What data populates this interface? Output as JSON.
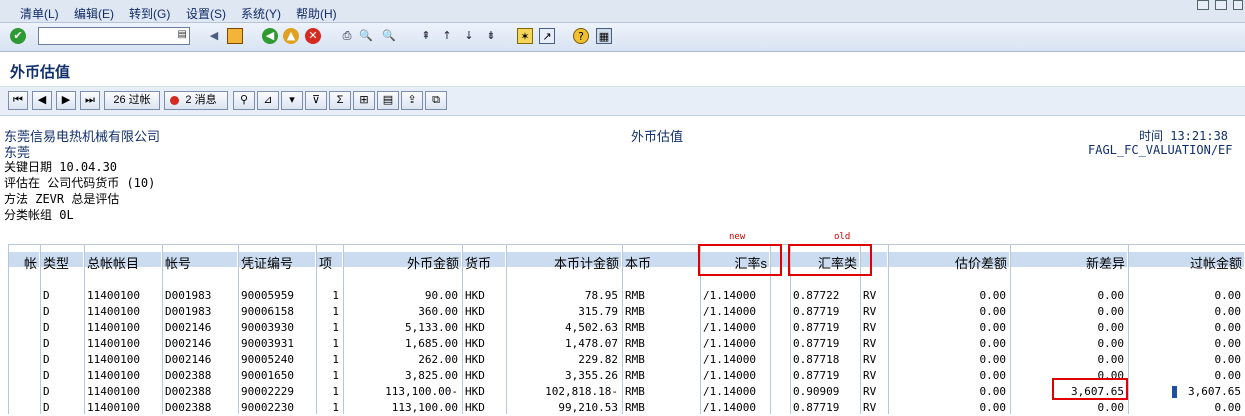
{
  "menu": {
    "items": [
      "清单(L)",
      "编辑(E)",
      "转到(G)",
      "设置(S)",
      "系统(Y)",
      "帮助(H)"
    ]
  },
  "toolbar": {
    "command_field_value": ""
  },
  "page": {
    "title": "外币估值"
  },
  "app_toolbar": {
    "posting_button": "26 过帐",
    "messages_button": "2 消息"
  },
  "report_header": {
    "company": "东莞信易电热机械有限公司",
    "city": "东莞",
    "key_date": "关键日期 10.04.30",
    "valuation_in": "评估在 公司代码货币 (10)",
    "method": "方法 ZEVR 总是评估",
    "ledger_group": "分类帐组 0L",
    "center_title": "外币估值",
    "time": "时间 13:21:38",
    "program": "FAGL_FC_VALUATION/EF"
  },
  "annotations": {
    "new_label": "new",
    "old_label": "old"
  },
  "table": {
    "columns": [
      "帐",
      "类型",
      "总帐帐目",
      "帐号",
      "凭证编号",
      "项",
      "外币金额",
      "货币",
      "本币计金额",
      "本币",
      "汇率s",
      "",
      "汇率类",
      "",
      "估价差额",
      "新差异",
      "过帐金额"
    ],
    "rows": [
      [
        "",
        "D",
        "11400100",
        "D001983",
        "90005959",
        "1",
        "90.00",
        "HKD",
        "78.95",
        "RMB",
        "/1.14000",
        "",
        "0.87722",
        "RV",
        "0.00",
        "0.00",
        "0.00"
      ],
      [
        "",
        "D",
        "11400100",
        "D001983",
        "90006158",
        "1",
        "360.00",
        "HKD",
        "315.79",
        "RMB",
        "/1.14000",
        "",
        "0.87719",
        "RV",
        "0.00",
        "0.00",
        "0.00"
      ],
      [
        "",
        "D",
        "11400100",
        "D002146",
        "90003930",
        "1",
        "5,133.00",
        "HKD",
        "4,502.63",
        "RMB",
        "/1.14000",
        "",
        "0.87719",
        "RV",
        "0.00",
        "0.00",
        "0.00"
      ],
      [
        "",
        "D",
        "11400100",
        "D002146",
        "90003931",
        "1",
        "1,685.00",
        "HKD",
        "1,478.07",
        "RMB",
        "/1.14000",
        "",
        "0.87719",
        "RV",
        "0.00",
        "0.00",
        "0.00"
      ],
      [
        "",
        "D",
        "11400100",
        "D002146",
        "90005240",
        "1",
        "262.00",
        "HKD",
        "229.82",
        "RMB",
        "/1.14000",
        "",
        "0.87718",
        "RV",
        "0.00",
        "0.00",
        "0.00"
      ],
      [
        "",
        "D",
        "11400100",
        "D002388",
        "90001650",
        "1",
        "3,825.00",
        "HKD",
        "3,355.26",
        "RMB",
        "/1.14000",
        "",
        "0.87719",
        "RV",
        "0.00",
        "0.00",
        "0.00"
      ],
      [
        "",
        "D",
        "11400100",
        "D002388",
        "90002229",
        "1",
        "113,100.00-",
        "HKD",
        "102,818.18-",
        "RMB",
        "/1.14000",
        "",
        "0.90909",
        "RV",
        "0.00",
        "3,607.65",
        "3,607.65"
      ],
      [
        "",
        "D",
        "11400100",
        "D002388",
        "90002230",
        "1",
        "113,100.00",
        "HKD",
        "99,210.53",
        "RMB",
        "/1.14000",
        "",
        "0.87719",
        "RV",
        "0.00",
        "0.00",
        "0.00"
      ]
    ]
  }
}
